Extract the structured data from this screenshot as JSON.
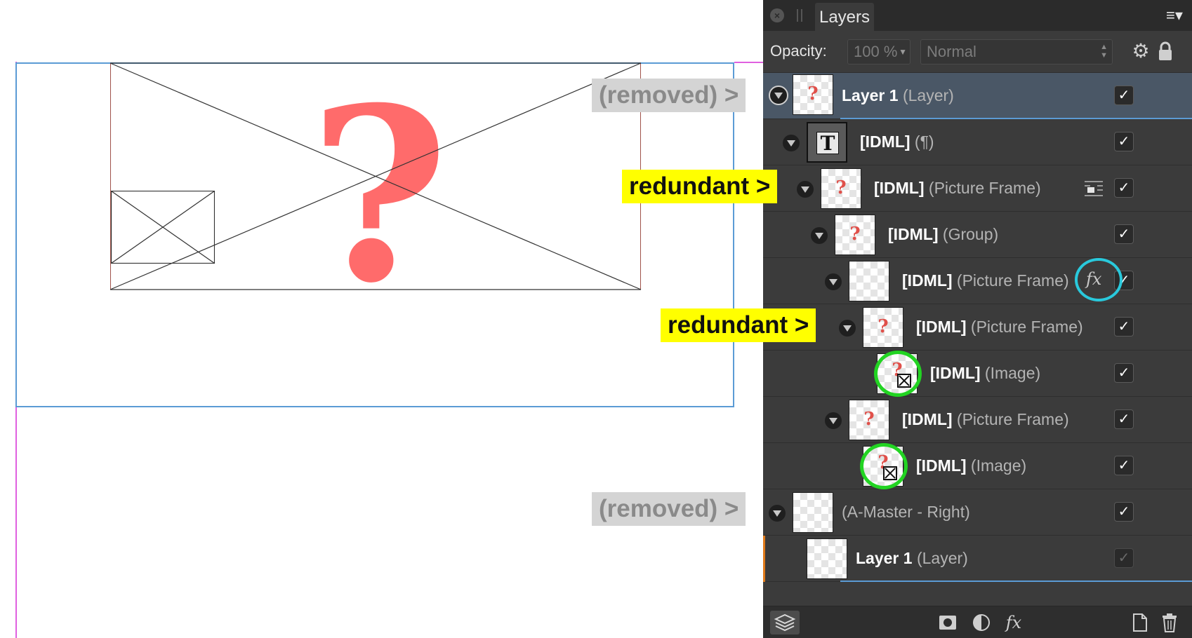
{
  "panel": {
    "tab_label": "Layers",
    "opacity_label": "Opacity:",
    "opacity_value": "100 %",
    "blend_mode": "Normal",
    "icons": [
      "close-icon",
      "grip-icon",
      "panel-menu-icon",
      "gear-icon",
      "lock-icon"
    ]
  },
  "layers": [
    {
      "name": "Layer 1",
      "type": "(Layer)"
    },
    {
      "name": "[IDML]",
      "type": "(¶)"
    },
    {
      "name": "[IDML]",
      "type": "(Picture Frame)"
    },
    {
      "name": "[IDML]",
      "type": "(Group)"
    },
    {
      "name": "[IDML]",
      "type": "(Picture Frame)",
      "badge": "fx"
    },
    {
      "name": "[IDML]",
      "type": "(Picture Frame)"
    },
    {
      "name": "[IDML]",
      "type": "(Image)"
    },
    {
      "name": "[IDML]",
      "type": "(Picture Frame)"
    },
    {
      "name": "[IDML]",
      "type": "(Image)"
    },
    {
      "name": "",
      "type": "(A-Master - Right)"
    },
    {
      "name": "Layer 1",
      "type": "(Layer)"
    }
  ],
  "visibility_check": "✓",
  "thumb_glyphs": {
    "question": "?",
    "text": "T"
  },
  "canvas": {
    "placeholder_glyph": "?"
  },
  "annotations": {
    "removed_1": "(removed) >",
    "redundant_1": "redundant >",
    "redundant_2": "redundant >",
    "removed_2": "(removed) >"
  },
  "bottom_bar": {
    "fx_label": "fx",
    "icons": [
      "layers-stack-icon",
      "mask-icon",
      "adjustment-icon",
      "fx-icon",
      "new-document-icon",
      "trash-icon"
    ]
  },
  "colors": {
    "panel_bg": "#3b3b3b",
    "selection": "#4a5766",
    "accent_blue": "#5b9bd5",
    "placeholder_red": "#ff6b6b",
    "annotation_yellow": "#ffff00",
    "annotation_gray": "#d4d4d4",
    "highlight_green": "#22d422",
    "highlight_cyan": "#29c9dc"
  }
}
